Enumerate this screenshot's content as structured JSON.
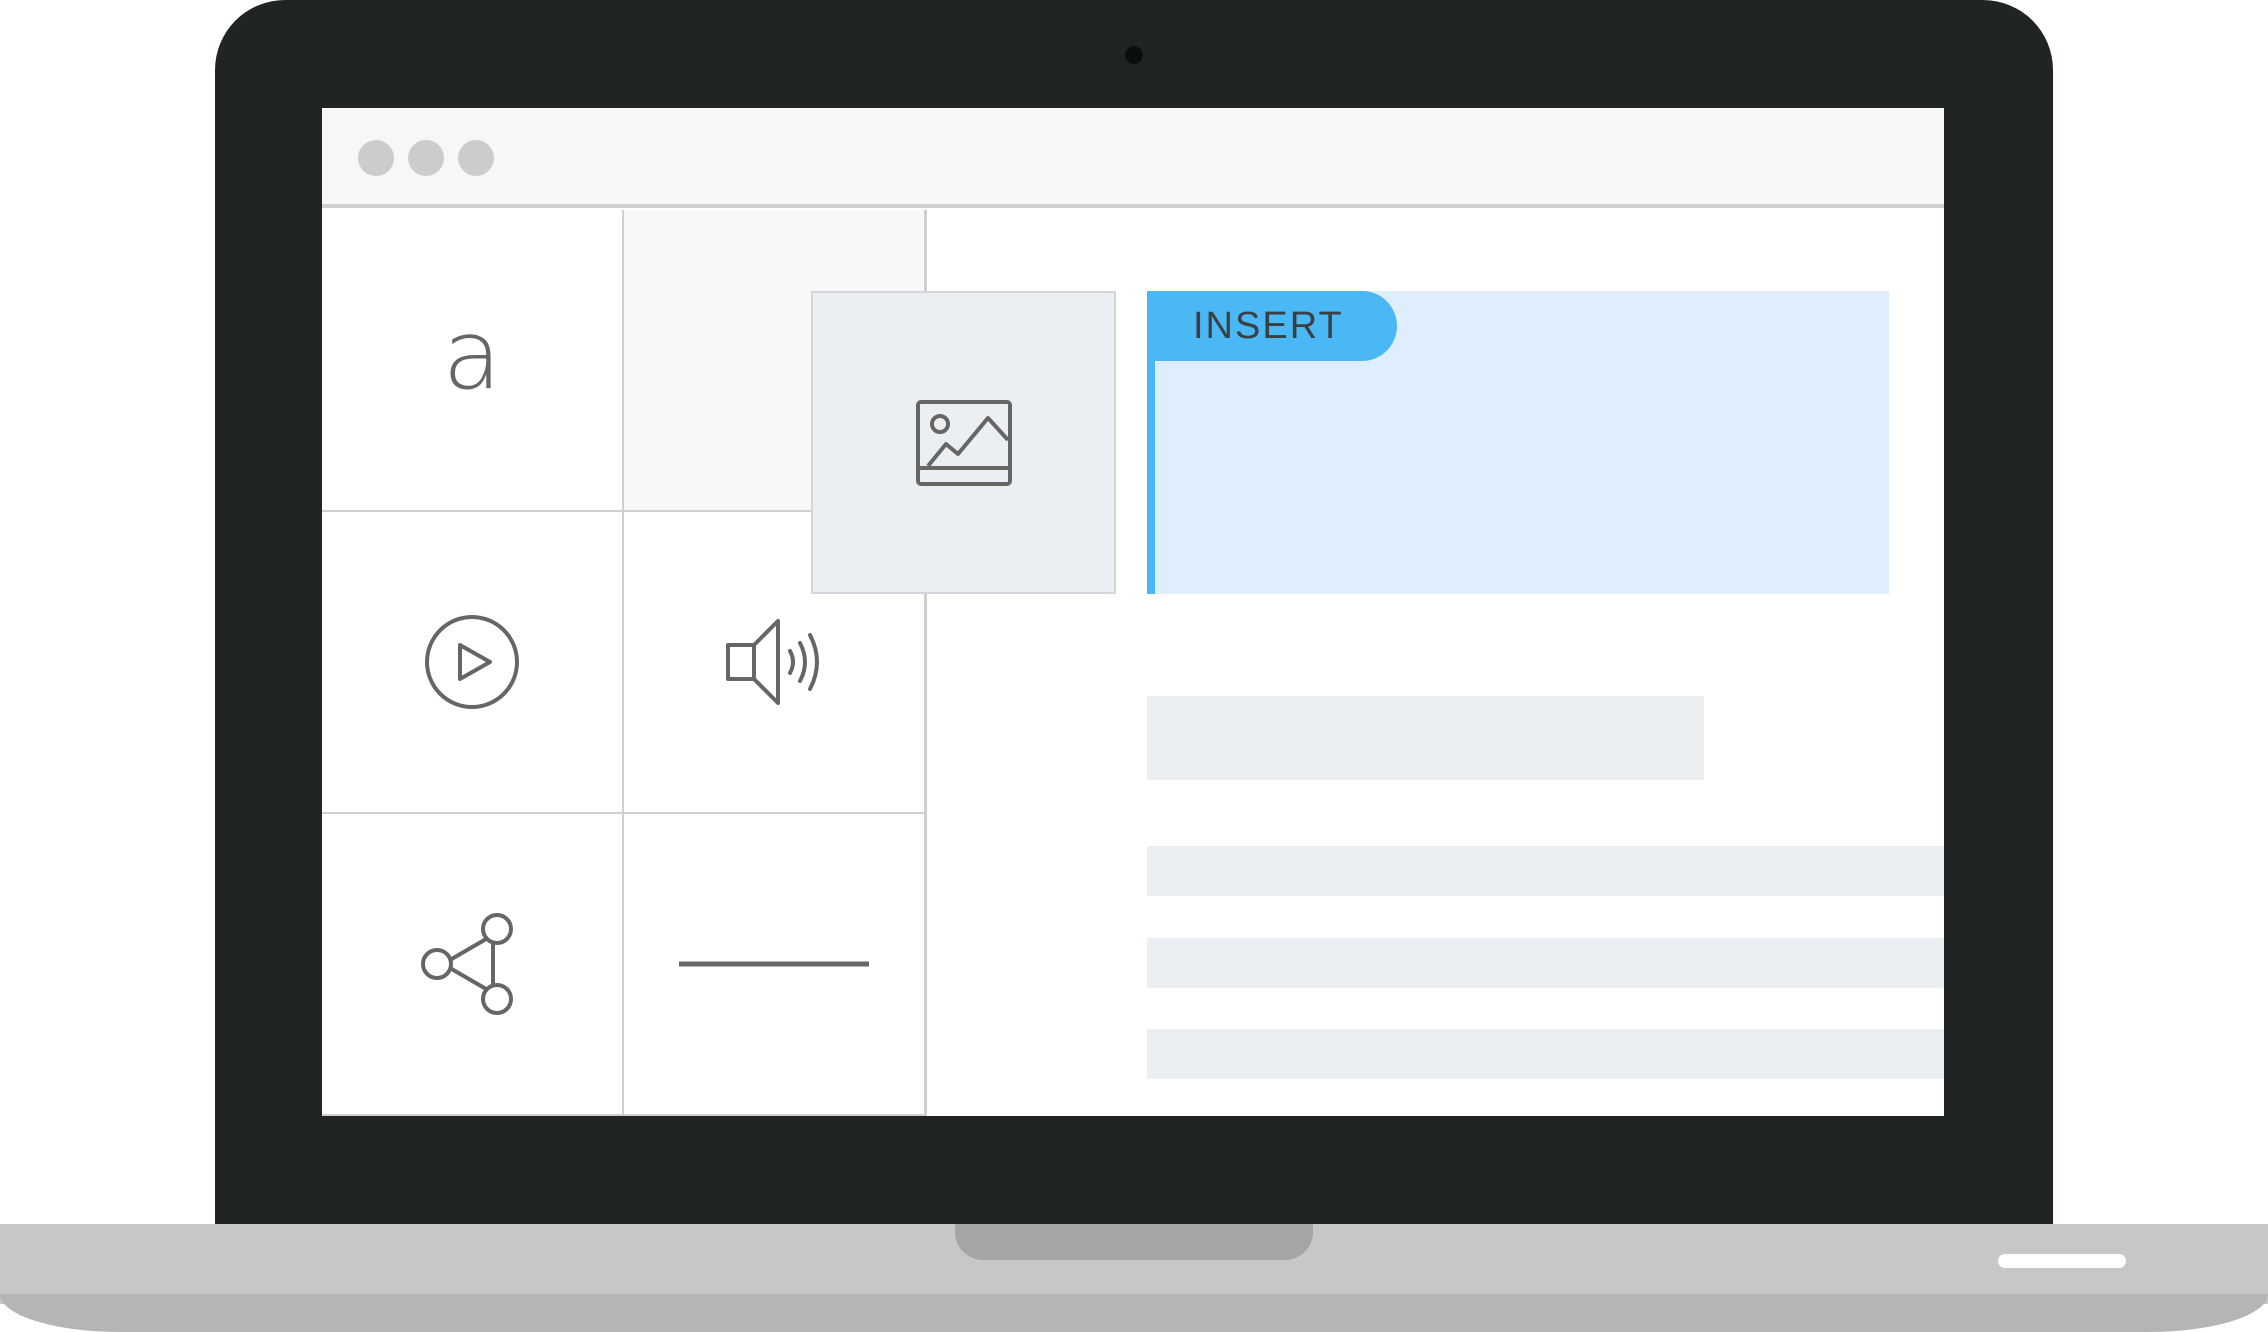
{
  "window": {
    "controls": [
      "window-dot",
      "window-dot",
      "window-dot"
    ]
  },
  "block_palette": {
    "items": [
      {
        "name": "text-block",
        "icon": "letter-a-icon",
        "glyph": "a"
      },
      {
        "name": "image-block",
        "icon": "image-icon",
        "state": "dragging"
      },
      {
        "name": "video-block",
        "icon": "play-circle-icon"
      },
      {
        "name": "audio-block",
        "icon": "speaker-icon"
      },
      {
        "name": "share-block",
        "icon": "share-icon"
      },
      {
        "name": "divider-block",
        "icon": "horizontal-line-icon"
      }
    ]
  },
  "editor": {
    "insert_label": "INSERT"
  },
  "colors": {
    "bezel": "#202425",
    "accent": "#4ab8f5",
    "drop_zone": "#dfeefd",
    "placeholder": "#eceff2",
    "icon": "#666666"
  }
}
